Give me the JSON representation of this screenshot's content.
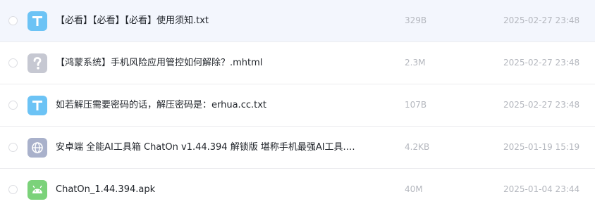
{
  "colors": {
    "text_icon": "#6cc3f5",
    "unknown_icon": "#c6c8d2",
    "web_icon": "#a9b1cb",
    "apk_icon": "#7bd27a",
    "hover_row": "#f3f6fd"
  },
  "files": [
    {
      "icon": "text-file-icon",
      "name": "【必看】【必看】【必看】使用须知.txt",
      "size": "329B",
      "date": "2025-02-27 23:48"
    },
    {
      "icon": "unknown-file-icon",
      "name": "【鸿蒙系统】手机风险应用管控如何解除？.mhtml",
      "size": "2.3M",
      "date": "2025-02-27 23:48"
    },
    {
      "icon": "text-file-icon",
      "name": "如若解压需要密码的话，解压密码是：erhua.cc.txt",
      "size": "107B",
      "date": "2025-02-27 23:48"
    },
    {
      "icon": "web-link-icon",
      "name": "安卓端 全能AI工具箱 ChatOn v1.44.394 解锁版 堪称手机最强AI工具.…",
      "size": "4.2KB",
      "date": "2025-01-19 15:19"
    },
    {
      "icon": "android-apk-icon",
      "name": "ChatOn_1.44.394.apk",
      "size": "40M",
      "date": "2025-01-04 23:44"
    }
  ]
}
